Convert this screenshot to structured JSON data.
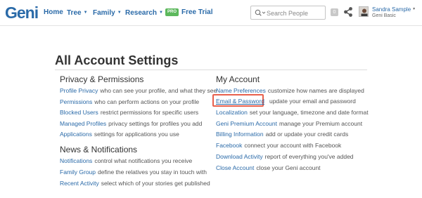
{
  "topbar": {
    "logo": "Geni",
    "nav": [
      {
        "label": "Home"
      },
      {
        "label": "Tree"
      },
      {
        "label": "Family"
      },
      {
        "label": "Research"
      }
    ],
    "pro_badge": "PRO",
    "free_trial": "Free Trial",
    "search_placeholder": "Search People",
    "notification_count": "0",
    "user_name": "Sandra Sample",
    "user_plan": "Geni Basic"
  },
  "page": {
    "title": "All Account Settings"
  },
  "left_sections": [
    {
      "title": "Privacy & Permissions",
      "items": [
        {
          "link": "Profile Privacy",
          "desc": "who can see your profile, and what they see"
        },
        {
          "link": "Permissions",
          "desc": "who can perform actions on your profile"
        },
        {
          "link": "Blocked Users",
          "desc": "restrict permissions for specific users"
        },
        {
          "link": "Managed Profiles",
          "desc": "privacy settings for profiles you add"
        },
        {
          "link": "Applications",
          "desc": "settings for applications you use"
        }
      ]
    },
    {
      "title": "News & Notifications",
      "items": [
        {
          "link": "Notifications",
          "desc": "control what notifications you receive"
        },
        {
          "link": "Family Group",
          "desc": "define the relatives you stay in touch with"
        },
        {
          "link": "Recent Activity",
          "desc": "select which of your stories get published"
        }
      ]
    }
  ],
  "right_section": {
    "title": "My Account",
    "items": [
      {
        "link": "Name Preferences",
        "desc": "customize how names are displayed"
      },
      {
        "link": "Email & Password",
        "desc": "update your email and password"
      },
      {
        "link": "Localization",
        "desc": "set your language, timezone and date format"
      },
      {
        "link": "Geni Premium Account",
        "desc": "manage your Premium account"
      },
      {
        "link": "Billing Information",
        "desc": "add or update your credit cards"
      },
      {
        "link": "Facebook",
        "desc": "connect your account with Facebook"
      },
      {
        "link": "Download Activity",
        "desc": "report of everything you've added"
      },
      {
        "link": "Close Account",
        "desc": "close your Geni account"
      }
    ]
  },
  "colors": {
    "link": "#2a6aa8",
    "pro_badge": "#5cb85c",
    "highlight": "#e8604c"
  }
}
